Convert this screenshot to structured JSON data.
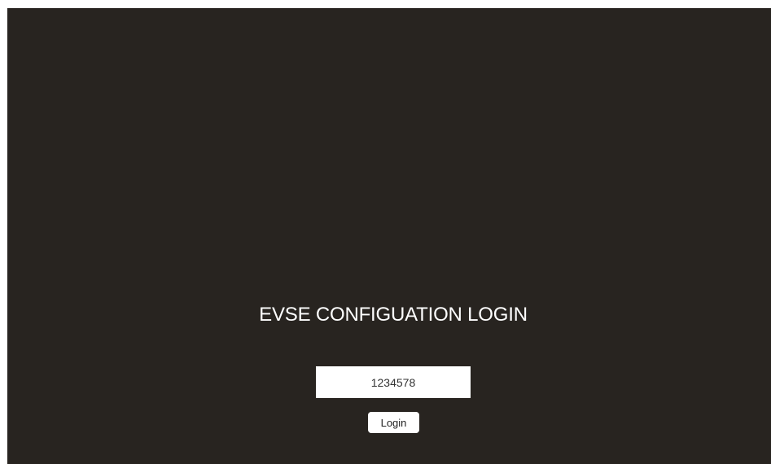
{
  "login": {
    "title": "EVSE CONFIGUATION LOGIN",
    "pin_value": "1234578",
    "button_label": "Login"
  },
  "colors": {
    "background": "#282420",
    "foreground": "#ffffff"
  }
}
